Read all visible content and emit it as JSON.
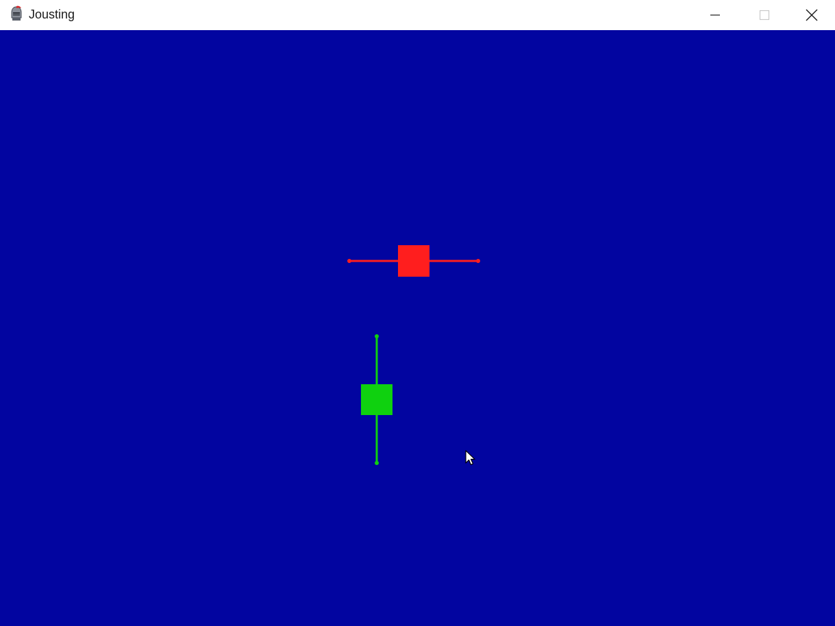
{
  "window": {
    "title": "Jousting",
    "icon": "knight-helmet-icon",
    "controls": {
      "minimize_icon": "minimize-icon",
      "maximize_icon": "maximize-icon",
      "close_icon": "close-icon"
    }
  },
  "game": {
    "background_color": "#0205a0",
    "players": [
      {
        "id": "red",
        "color": "#ff1e1e",
        "lance_orientation": "horizontal"
      },
      {
        "id": "green",
        "color": "#0fd10f",
        "lance_orientation": "vertical"
      }
    ],
    "cursor_icon": "mouse-pointer-icon"
  }
}
